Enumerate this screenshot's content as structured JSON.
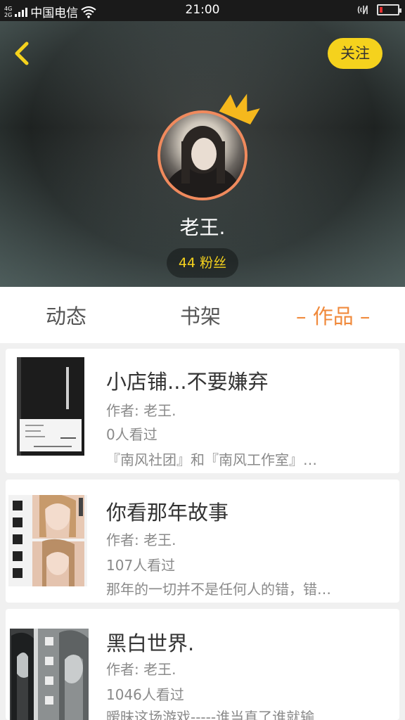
{
  "status_bar": {
    "network_top": "4G",
    "network_bottom": "2G",
    "carrier": "中国电信",
    "time": "21:00"
  },
  "profile": {
    "follow_label": "关注",
    "username": "老王.",
    "fans_label": "44 粉丝"
  },
  "tabs": [
    {
      "label": "动态"
    },
    {
      "label": "书架"
    },
    {
      "label": "– 作品 –"
    }
  ],
  "books": [
    {
      "title": "小店铺...不要嫌弃",
      "author": "作者: 老王.",
      "views": "0人看过",
      "desc": "『南风社团』和『南风工作室』…"
    },
    {
      "title": "你看那年故事",
      "author": "作者: 老王.",
      "views": "107人看过",
      "desc": "那年的一切并不是任何人的错，错…"
    },
    {
      "title": "黑白世界.",
      "author": "作者: 老王.",
      "views": "1046人看过",
      "desc": "暧昧这场游戏-----谁当真了谁就输…"
    }
  ],
  "colors": {
    "accent": "#f08a3c",
    "follow_bg": "#f5d21d",
    "avatar_border": "#f08a5d"
  }
}
